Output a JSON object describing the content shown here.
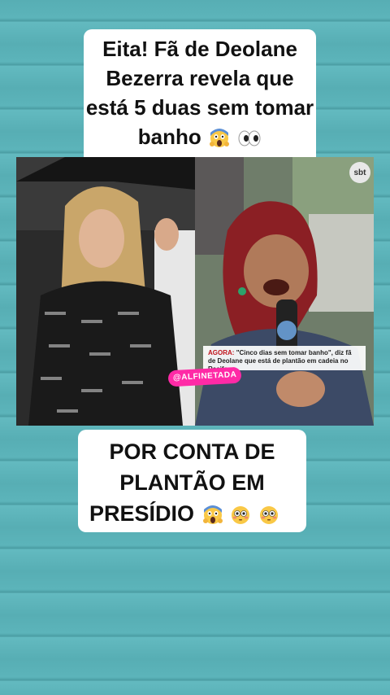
{
  "top_caption": {
    "line1": "Eita! Fã de Deolane",
    "line2": "Bezerra revela que",
    "line3": "está 5 duas sem tomar",
    "line4": "banho",
    "emojis": [
      "face-screaming-in-fear",
      "eyes"
    ]
  },
  "photos": {
    "left_handle": "@ALFINETADA",
    "right_logo": "sbt",
    "ticker_tag": "AGORA:",
    "ticker_text": "\"Cinco dias sem tomar banho\", diz fã de Deolane que está de plantão em cadeia no Recife"
  },
  "bottom_caption": {
    "line1": "POR CONTA DE",
    "line2": "PLANTÃO EM",
    "line3": "PRESÍDIO",
    "emojis": [
      "face-screaming-in-fear",
      "flushed-face",
      "flushed-face"
    ]
  },
  "colors": {
    "background": "#57aeb4",
    "caption_bg": "#ffffff",
    "handle_pink": "#ff2aa6",
    "ticker_red": "#c0141c"
  }
}
